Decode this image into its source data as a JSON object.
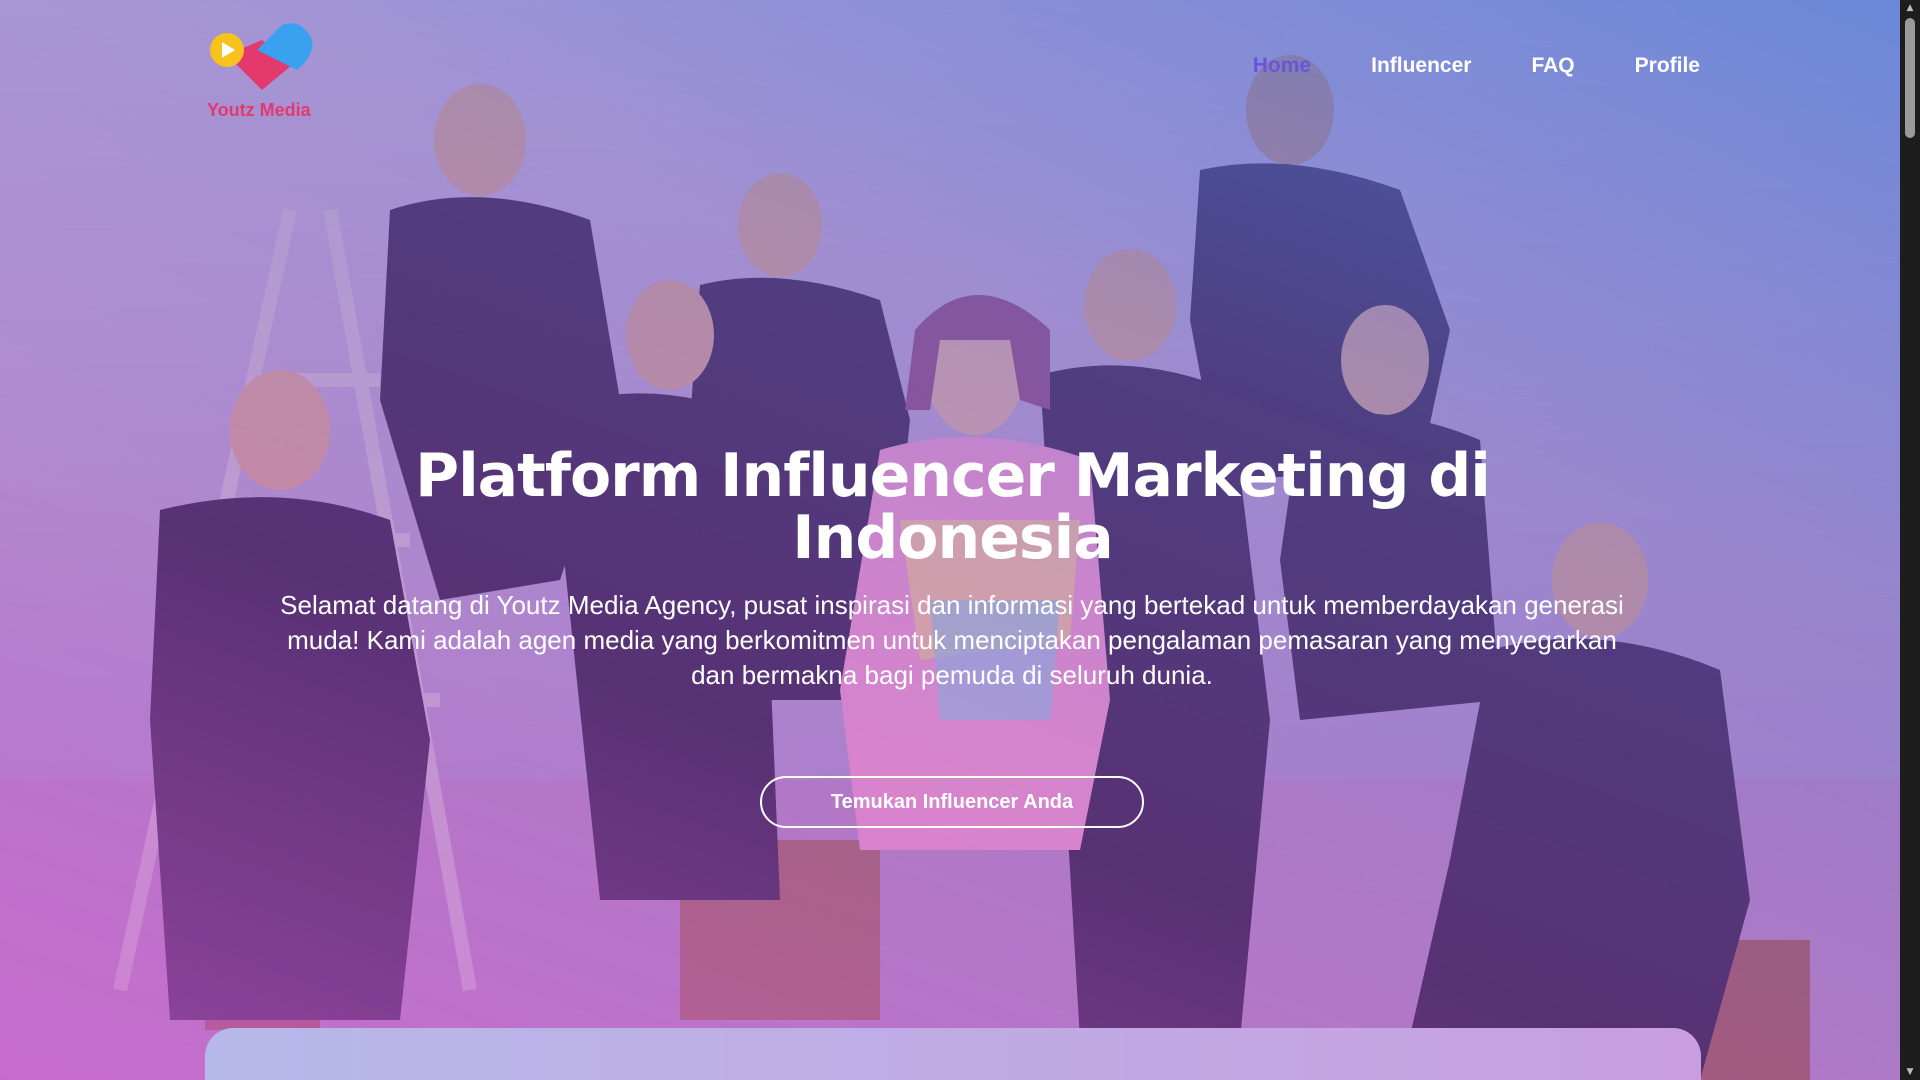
{
  "brand": {
    "name": "Youtz Media",
    "colors": {
      "text": "#e3396d",
      "blue": "#3aa0f0",
      "pink": "#e3396d",
      "yellow": "#f6c21c"
    }
  },
  "nav": {
    "items": [
      {
        "label": "Home",
        "active": true
      },
      {
        "label": "Influencer",
        "active": false
      },
      {
        "label": "FAQ",
        "active": false
      },
      {
        "label": "Profile",
        "active": false
      }
    ],
    "active_color": "#6a55d8"
  },
  "hero": {
    "title": "Platform Influencer Marketing di Indonesia",
    "subtitle": "Selamat datang di Youtz Media Agency, pusat inspirasi dan informasi yang bertekad untuk memberdayakan generasi muda! Kami adalah agen media yang berkomitmen untuk menciptakan pengalaman pemasaran yang menyegarkan dan bermakna bagi pemuda di seluruh dunia.",
    "cta_label": "Temukan Influencer Anda",
    "background_image": "group-photo"
  },
  "icons": {
    "scroll_up": "arrow-up-icon",
    "scroll_down": "arrow-down-icon",
    "logo": "youtz-media-logo"
  }
}
